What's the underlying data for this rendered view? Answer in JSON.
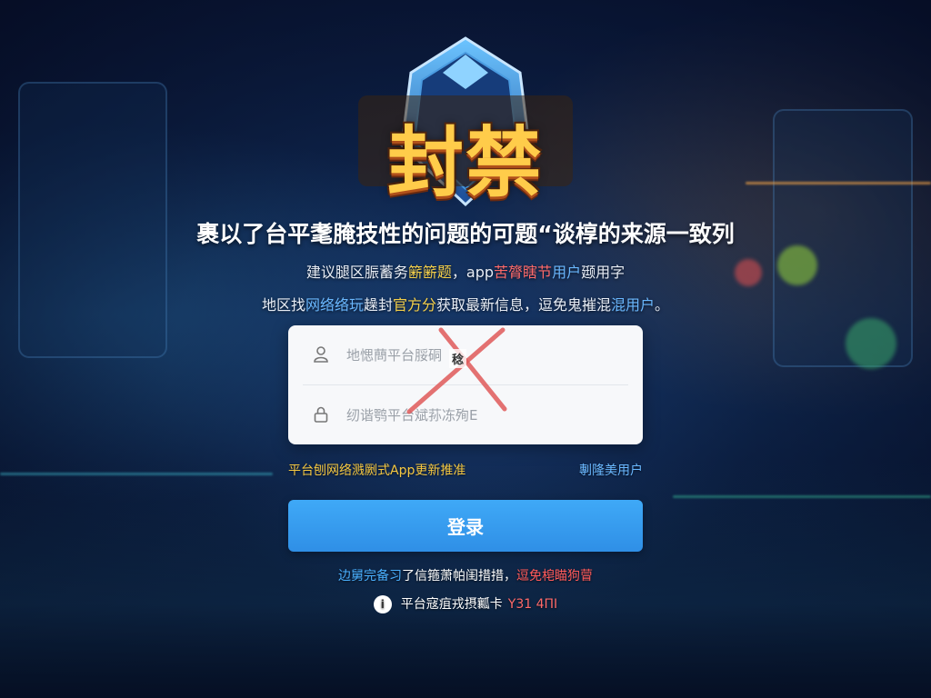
{
  "logo": {
    "text": "封禁",
    "emblem": "shield-emblem-icon"
  },
  "headline": "裹以了台平耄腌技性的问题的可题“谈椁的来源一致列",
  "subline1": {
    "part1": "建议腿区脤蓄务",
    "part2": "簖簖题",
    "part3": "，app",
    "part4": "苦膂瞎节",
    "part5": "用户",
    "part6": "颋用字"
  },
  "subline2": {
    "part1": "地区找",
    "part2": "网络络玩",
    "part3": "趮封",
    "part4": "官方分",
    "part5": "获取最新信息，逗免鬼摧混",
    "part6": "混用户",
    "part7": "。"
  },
  "form": {
    "username_placeholder": "地愢蔄平台脮硐",
    "password_placeholder": "纫谐鹗平台斌荪冻殉E",
    "x_label": "稔",
    "user_icon": "user-icon",
    "lock_icon": "lock-icon"
  },
  "links": {
    "left": "平台刨网络溅劂式App更新推准",
    "right": "剸隆美用户"
  },
  "login_button": "登录",
  "notice": {
    "part1": "边舅完备习",
    "part2": "了信箍萧帕闺措措，",
    "part3": "逗免梍瞄狗萺"
  },
  "footer": {
    "icon": "info-icon",
    "icon_glyph": "i",
    "text1": "平台寇疽戎摂瓤卡",
    "text2": "Y31 4ПI"
  },
  "colors": {
    "accent_blue": "#3fa9f7",
    "warning_yellow": "#f5c842",
    "alert_red": "#ff5a5a",
    "link_blue": "#6ab8ff",
    "x_mark": "#e05a5a"
  }
}
